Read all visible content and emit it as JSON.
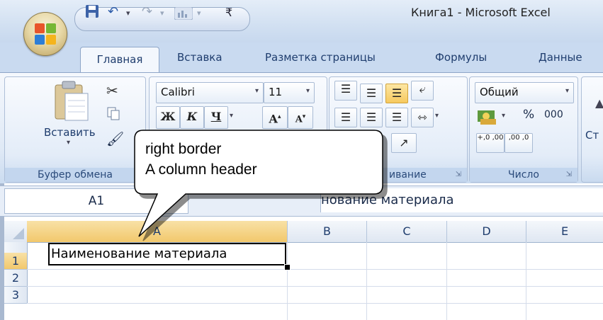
{
  "window": {
    "title": "Книга1 - Microsoft Excel"
  },
  "quick_access": {
    "icons": [
      "office-logo-icon",
      "save-icon",
      "undo-icon",
      "redo-icon",
      "chart-icon",
      "customize-icon"
    ]
  },
  "tabs": [
    {
      "label": "Главная",
      "active": true
    },
    {
      "label": "Вставка"
    },
    {
      "label": "Разметка страницы"
    },
    {
      "label": "Формулы"
    },
    {
      "label": "Данные"
    }
  ],
  "clipboard": {
    "paste_label": "Вставить",
    "group_label": "Буфер обмена"
  },
  "font": {
    "name": "Calibri",
    "size": "11",
    "bold": "Ж",
    "italic": "К",
    "underline": "Ч",
    "grow": "A",
    "shrink": "A"
  },
  "alignment": {
    "group_label": "ивание"
  },
  "number": {
    "format": "Общий",
    "percent": "%",
    "thousands": "000",
    "inc_dec": "+,0 ,00",
    "dec_dec": ",00 ,0",
    "group_label": "Число"
  },
  "styles": {
    "label_fragment": "Ст"
  },
  "formula_bar": {
    "name_box": "A1",
    "value": "нование материала"
  },
  "columns": [
    "A",
    "B",
    "C",
    "D",
    "E"
  ],
  "rows": [
    "1",
    "2",
    "3"
  ],
  "cells": {
    "A1": "Наименование материала"
  },
  "callout": {
    "line1": "right border",
    "line2": "A column header"
  },
  "colors": {
    "accent": "#c9daf0",
    "header_highlight": "#f2c86c",
    "ribbon_bg": "#dfe9f6"
  }
}
